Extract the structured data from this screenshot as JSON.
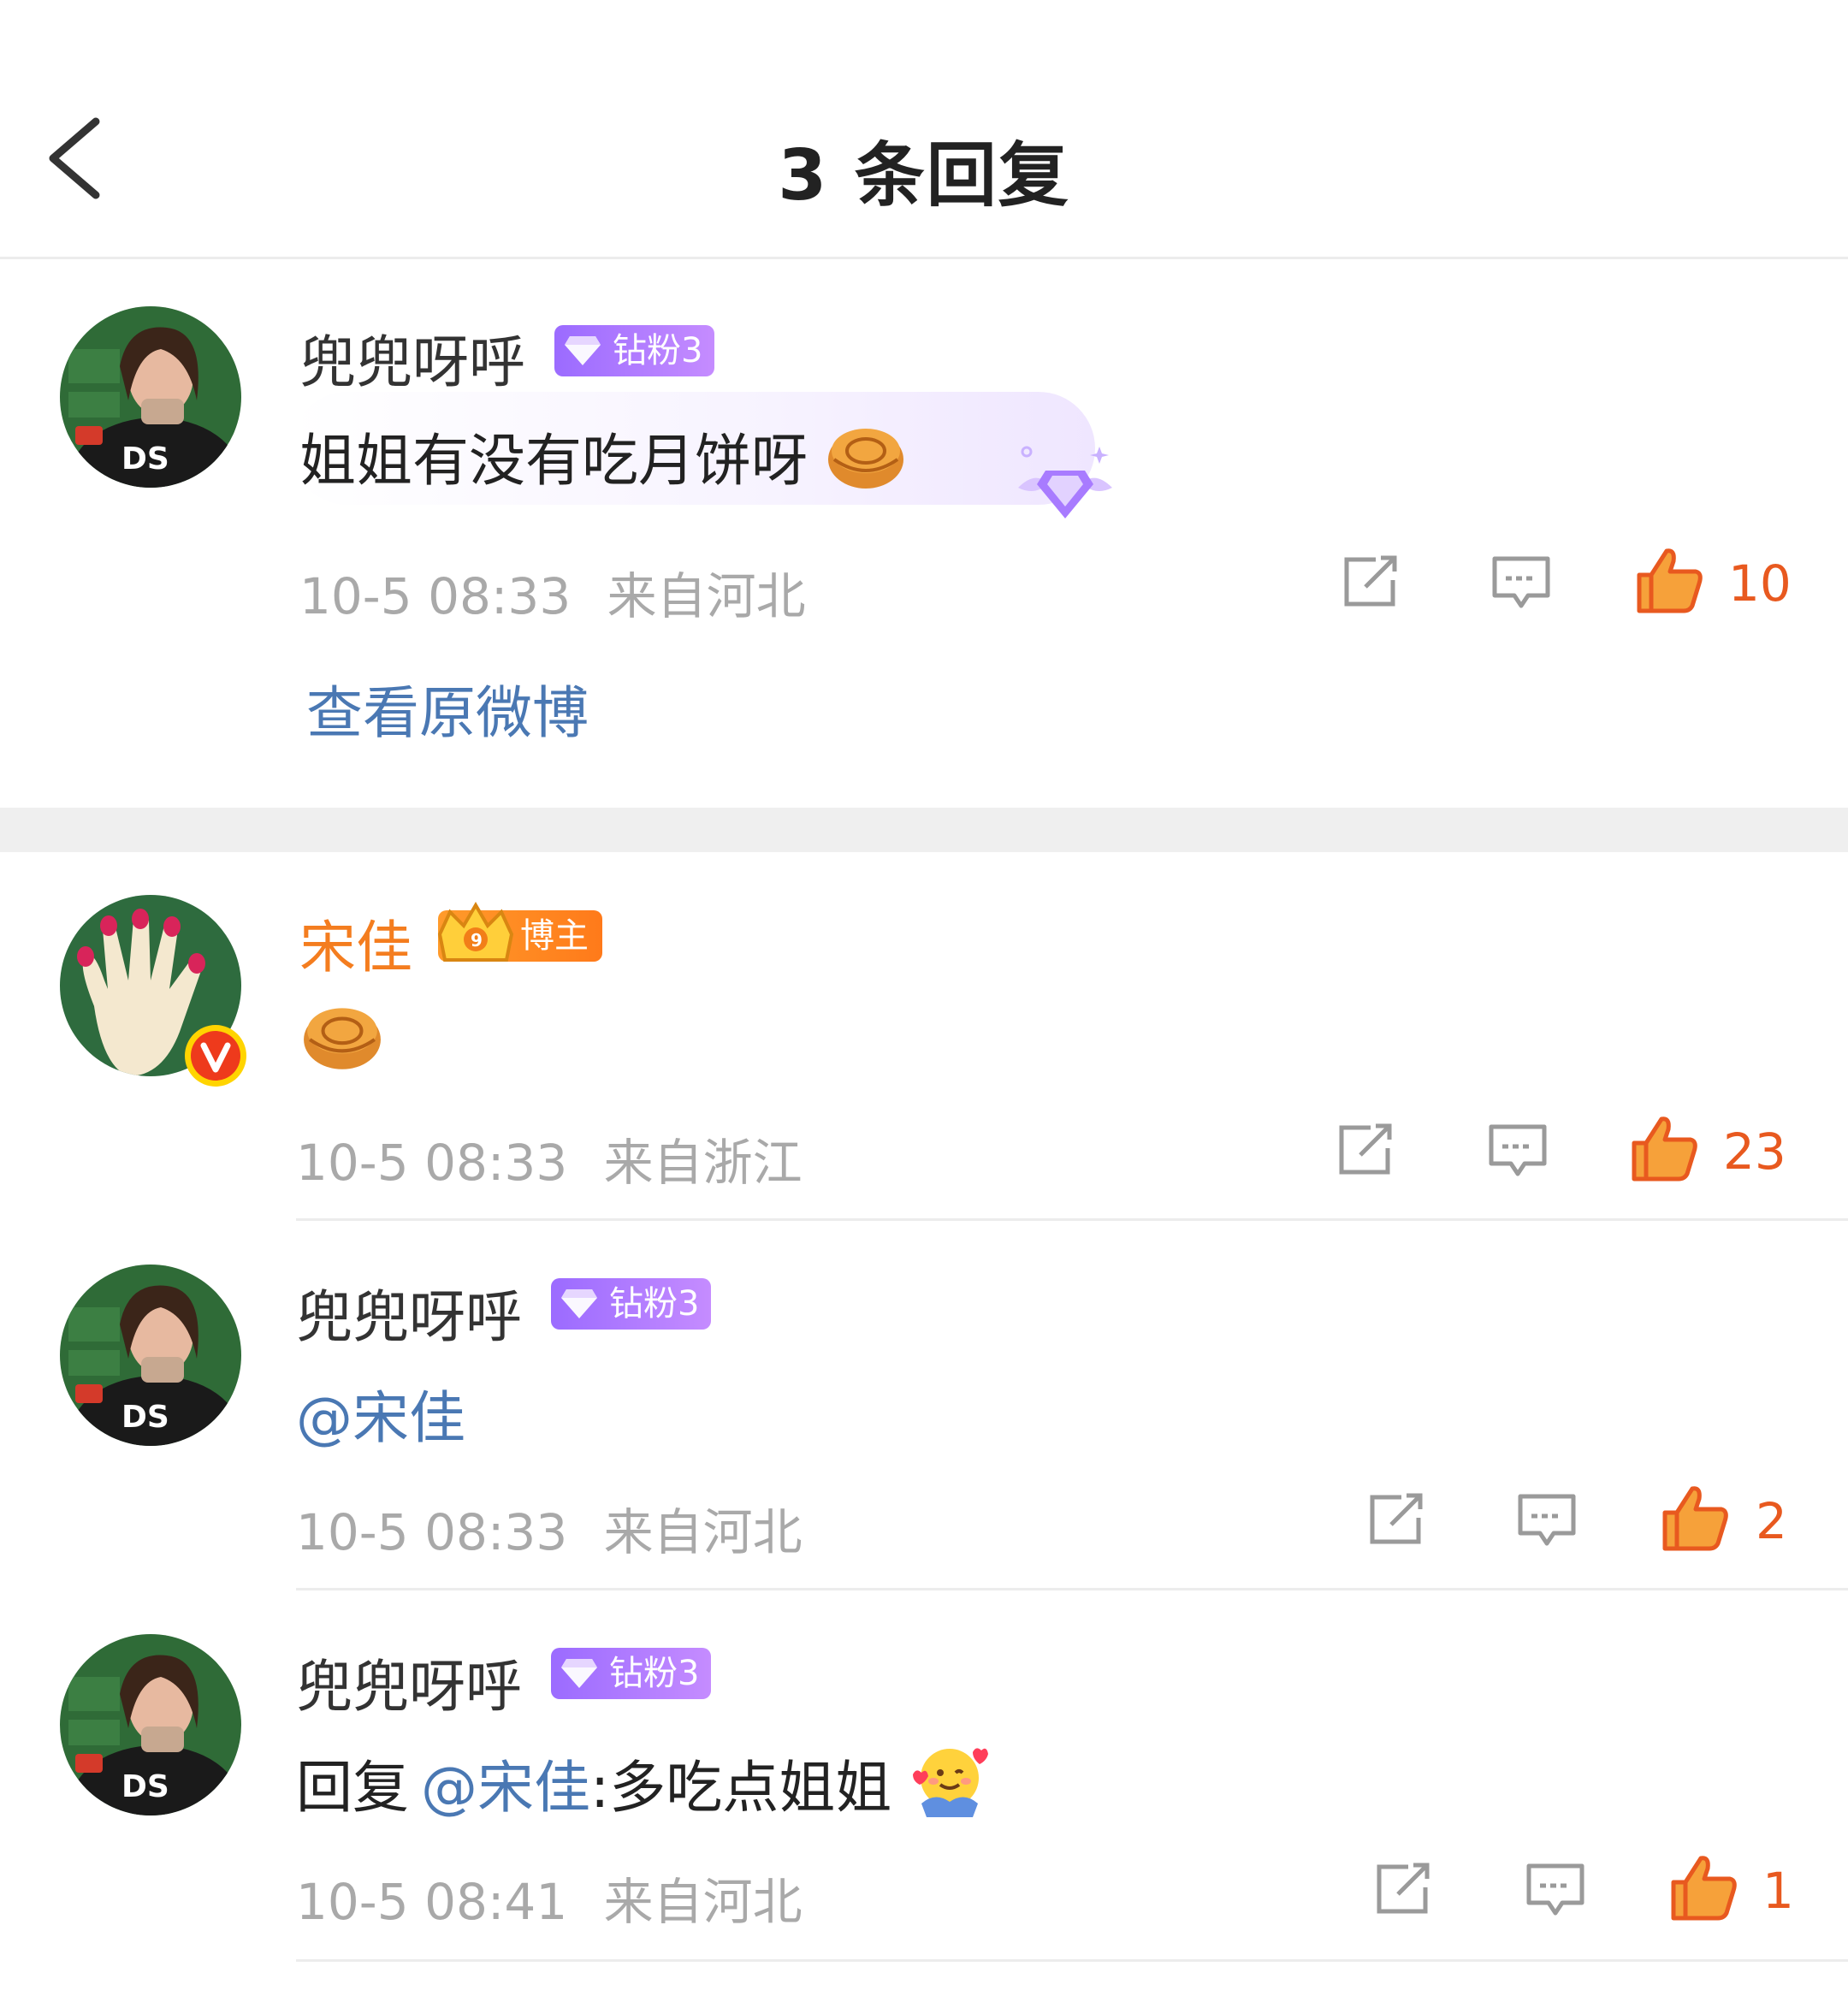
{
  "header": {
    "back_label": "",
    "title": "3 条回复"
  },
  "root_comment": {
    "username": "兜兜呀呼",
    "fan_badge": "钻粉3",
    "text": "姐姐有没有吃月饼呀",
    "time": "10-5 08:33",
    "location": "来自河北",
    "likes": "10",
    "view_original": "查看原微博"
  },
  "replies": [
    {
      "username": "宋佳",
      "badge": "博主",
      "time": "10-5 08:33",
      "location": "来自浙江",
      "likes": "23"
    },
    {
      "username": "兜兜呀呼",
      "fan_badge": "钻粉3",
      "mention": "@宋佳",
      "time": "10-5 08:33",
      "location": "来自河北",
      "likes": "2"
    },
    {
      "username": "兜兜呀呼",
      "fan_badge": "钻粉3",
      "prefix": "回复",
      "mention": "@宋佳",
      "suffix": ":多吃点姐姐",
      "time": "10-5 08:41",
      "location": "来自河北",
      "likes": "1"
    }
  ],
  "colors": {
    "mention": "#4a78b3",
    "like": "#e8591f",
    "blogger": "#f47d1f",
    "fan_badge": "#a77bff"
  }
}
